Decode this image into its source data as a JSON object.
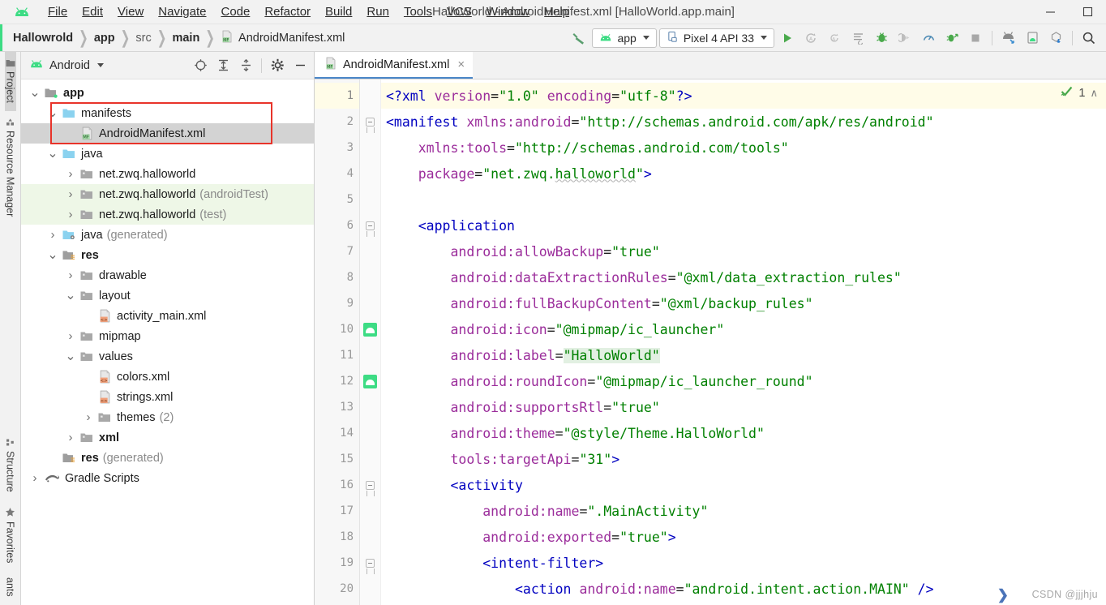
{
  "window": {
    "title": "HalloWorld - AndroidManifest.xml [HalloWorld.app.main]",
    "minimize": "—",
    "maximize": "☐"
  },
  "menu": {
    "items": [
      "File",
      "Edit",
      "View",
      "Navigate",
      "Code",
      "Refactor",
      "Build",
      "Run",
      "Tools",
      "VCS",
      "Window",
      "Help"
    ]
  },
  "breadcrumb": {
    "items": [
      "Hallowrold",
      "app",
      "src",
      "main",
      "AndroidManifest.xml"
    ],
    "separator": "❯"
  },
  "toolbar": {
    "build_hammer": "hammer-icon",
    "run_config": "app",
    "device": "Pixel 4 API 33",
    "run": "run-icon",
    "apply_changes": "apply-changes-icon",
    "icons": [
      "apply-code-changes-icon",
      "logcat-icon",
      "debug-icon",
      "attach-debugger-icon",
      "profiler-icon",
      "run-with-coverage-icon",
      "stop-icon",
      "sdk-manager-icon",
      "avd-manager-icon",
      "sync-gradle-icon",
      "search-everywhere-icon"
    ]
  },
  "toolstrip": {
    "tabs": [
      {
        "label": "Project",
        "icon": "project-folder-icon",
        "selected": true
      },
      {
        "label": "Resource Manager",
        "icon": "resource-manager-icon",
        "selected": false
      },
      {
        "label": "Structure",
        "icon": "structure-icon",
        "selected": false
      },
      {
        "label": "Favorites",
        "icon": "star-icon",
        "selected": false
      },
      {
        "label": "ants",
        "icon": "build-variants-icon",
        "selected": false
      }
    ]
  },
  "project_panel": {
    "view_selector": "Android",
    "actions": [
      "select-opened-file-icon",
      "expand-all-icon",
      "collapse-all-icon",
      "settings-gear-icon",
      "hide-panel-icon"
    ],
    "tree": [
      {
        "indent": 0,
        "arrow": "down",
        "icon": "module-folder-icon",
        "label": "app",
        "suffix": "",
        "bold": true,
        "selected": false,
        "green": false
      },
      {
        "indent": 1,
        "arrow": "down",
        "icon": "folder-icon",
        "label": "manifests",
        "suffix": "",
        "bold": false,
        "selected": false,
        "green": false
      },
      {
        "indent": 2,
        "arrow": "none",
        "icon": "manifest-file-icon",
        "label": "AndroidManifest.xml",
        "suffix": "",
        "bold": false,
        "selected": true,
        "green": false
      },
      {
        "indent": 1,
        "arrow": "down",
        "icon": "folder-icon",
        "label": "java",
        "suffix": "",
        "bold": false,
        "selected": false,
        "green": false
      },
      {
        "indent": 2,
        "arrow": "right",
        "icon": "package-icon",
        "label": "net.zwq.halloworld",
        "suffix": "",
        "bold": false,
        "selected": false,
        "green": false
      },
      {
        "indent": 2,
        "arrow": "right",
        "icon": "package-icon",
        "label": "net.zwq.halloworld",
        "suffix": "(androidTest)",
        "bold": false,
        "selected": false,
        "green": true
      },
      {
        "indent": 2,
        "arrow": "right",
        "icon": "package-icon",
        "label": "net.zwq.halloworld",
        "suffix": "(test)",
        "bold": false,
        "selected": false,
        "green": true
      },
      {
        "indent": 1,
        "arrow": "right",
        "icon": "generated-folder-icon",
        "label": "java",
        "suffix": "(generated)",
        "bold": false,
        "selected": false,
        "green": false
      },
      {
        "indent": 1,
        "arrow": "down",
        "icon": "res-folder-icon",
        "label": "res",
        "suffix": "",
        "bold": true,
        "selected": false,
        "green": false
      },
      {
        "indent": 2,
        "arrow": "right",
        "icon": "package-icon",
        "label": "drawable",
        "suffix": "",
        "bold": false,
        "selected": false,
        "green": false
      },
      {
        "indent": 2,
        "arrow": "down",
        "icon": "package-icon",
        "label": "layout",
        "suffix": "",
        "bold": false,
        "selected": false,
        "green": false
      },
      {
        "indent": 3,
        "arrow": "none",
        "icon": "xml-file-icon",
        "label": "activity_main.xml",
        "suffix": "",
        "bold": false,
        "selected": false,
        "green": false
      },
      {
        "indent": 2,
        "arrow": "right",
        "icon": "package-icon",
        "label": "mipmap",
        "suffix": "",
        "bold": false,
        "selected": false,
        "green": false
      },
      {
        "indent": 2,
        "arrow": "down",
        "icon": "package-icon",
        "label": "values",
        "suffix": "",
        "bold": false,
        "selected": false,
        "green": false
      },
      {
        "indent": 3,
        "arrow": "none",
        "icon": "xml-file-icon",
        "label": "colors.xml",
        "suffix": "",
        "bold": false,
        "selected": false,
        "green": false
      },
      {
        "indent": 3,
        "arrow": "none",
        "icon": "xml-file-icon",
        "label": "strings.xml",
        "suffix": "",
        "bold": false,
        "selected": false,
        "green": false
      },
      {
        "indent": 3,
        "arrow": "right",
        "icon": "package-icon",
        "label": "themes",
        "suffix": "(2)",
        "bold": false,
        "selected": false,
        "green": false
      },
      {
        "indent": 2,
        "arrow": "right",
        "icon": "package-icon",
        "label": "xml",
        "suffix": "",
        "bold": true,
        "selected": false,
        "green": false
      },
      {
        "indent": 1,
        "arrow": "none",
        "icon": "generated-res-icon",
        "label": "res",
        "suffix": "(generated)",
        "bold": true,
        "selected": false,
        "green": false
      },
      {
        "indent": 0,
        "arrow": "right",
        "icon": "gradle-icon",
        "label": "Gradle Scripts",
        "suffix": "",
        "bold": false,
        "selected": false,
        "green": false
      }
    ]
  },
  "editor": {
    "tab": {
      "label": "AndroidManifest.xml",
      "icon": "manifest-file-icon",
      "close": "×"
    },
    "inspection": {
      "count": "1",
      "icon": "inspection-ok-icon",
      "chevron": "∧"
    },
    "lines": [
      {
        "n": "1",
        "current": true,
        "fold": "none",
        "gutter_icon": "none",
        "tokens": [
          {
            "t": "<?xml ",
            "c": "tok-pi"
          },
          {
            "t": "version",
            "c": "tok-attr"
          },
          {
            "t": "=",
            "c": "tok-plain"
          },
          {
            "t": "\"1.0\"",
            "c": "tok-str"
          },
          {
            "t": " ",
            "c": "tok-plain"
          },
          {
            "t": "encoding",
            "c": "tok-attr"
          },
          {
            "t": "=",
            "c": "tok-plain"
          },
          {
            "t": "\"utf-8\"",
            "c": "tok-str"
          },
          {
            "t": "?>",
            "c": "tok-pi"
          }
        ]
      },
      {
        "n": "2",
        "current": false,
        "fold": "open",
        "gutter_icon": "none",
        "tokens": [
          {
            "t": "<manifest ",
            "c": "tok-tag"
          },
          {
            "t": "xmlns:android",
            "c": "tok-attr"
          },
          {
            "t": "=",
            "c": "tok-plain"
          },
          {
            "t": "\"http://schemas.android.com/apk/res/android\"",
            "c": "tok-str"
          }
        ]
      },
      {
        "n": "3",
        "current": false,
        "fold": "none",
        "gutter_icon": "none",
        "tokens": [
          {
            "t": "    ",
            "c": "tok-plain"
          },
          {
            "t": "xmlns:tools",
            "c": "tok-attr"
          },
          {
            "t": "=",
            "c": "tok-plain"
          },
          {
            "t": "\"http://schemas.android.com/tools\"",
            "c": "tok-str"
          }
        ]
      },
      {
        "n": "4",
        "current": false,
        "fold": "none",
        "gutter_icon": "none",
        "tokens": [
          {
            "t": "    ",
            "c": "tok-plain"
          },
          {
            "t": "package",
            "c": "tok-attr"
          },
          {
            "t": "=",
            "c": "tok-plain"
          },
          {
            "t": "\"net.zwq.",
            "c": "tok-str"
          },
          {
            "t": "halloworld",
            "c": "tok-str squiggle"
          },
          {
            "t": "\"",
            "c": "tok-str"
          },
          {
            "t": ">",
            "c": "tok-tag"
          }
        ]
      },
      {
        "n": "5",
        "current": false,
        "fold": "none",
        "gutter_icon": "none",
        "tokens": []
      },
      {
        "n": "6",
        "current": false,
        "fold": "open",
        "gutter_icon": "none",
        "tokens": [
          {
            "t": "    ",
            "c": "tok-plain"
          },
          {
            "t": "<application",
            "c": "tok-tag"
          }
        ]
      },
      {
        "n": "7",
        "current": false,
        "fold": "none",
        "gutter_icon": "none",
        "tokens": [
          {
            "t": "        ",
            "c": "tok-plain"
          },
          {
            "t": "android:allowBackup",
            "c": "tok-attr"
          },
          {
            "t": "=",
            "c": "tok-plain"
          },
          {
            "t": "\"true\"",
            "c": "tok-str"
          }
        ]
      },
      {
        "n": "8",
        "current": false,
        "fold": "none",
        "gutter_icon": "none",
        "tokens": [
          {
            "t": "        ",
            "c": "tok-plain"
          },
          {
            "t": "android:dataExtractionRules",
            "c": "tok-attr"
          },
          {
            "t": "=",
            "c": "tok-plain"
          },
          {
            "t": "\"@xml/data_extraction_rules\"",
            "c": "tok-str"
          }
        ]
      },
      {
        "n": "9",
        "current": false,
        "fold": "none",
        "gutter_icon": "none",
        "tokens": [
          {
            "t": "        ",
            "c": "tok-plain"
          },
          {
            "t": "android:fullBackupContent",
            "c": "tok-attr"
          },
          {
            "t": "=",
            "c": "tok-plain"
          },
          {
            "t": "\"@xml/backup_rules\"",
            "c": "tok-str"
          }
        ]
      },
      {
        "n": "10",
        "current": false,
        "fold": "none",
        "gutter_icon": "launcher",
        "tokens": [
          {
            "t": "        ",
            "c": "tok-plain"
          },
          {
            "t": "android:icon",
            "c": "tok-attr"
          },
          {
            "t": "=",
            "c": "tok-plain"
          },
          {
            "t": "\"@mipmap/ic_launcher\"",
            "c": "tok-str"
          }
        ]
      },
      {
        "n": "11",
        "current": false,
        "fold": "none",
        "gutter_icon": "none",
        "tokens": [
          {
            "t": "        ",
            "c": "tok-plain"
          },
          {
            "t": "android:label",
            "c": "tok-attr"
          },
          {
            "t": "=",
            "c": "tok-plain"
          },
          {
            "t": "\"HalloWorld\"",
            "c": "tok-str hl-green"
          }
        ]
      },
      {
        "n": "12",
        "current": false,
        "fold": "none",
        "gutter_icon": "launcher",
        "tokens": [
          {
            "t": "        ",
            "c": "tok-plain"
          },
          {
            "t": "android:roundIcon",
            "c": "tok-attr"
          },
          {
            "t": "=",
            "c": "tok-plain"
          },
          {
            "t": "\"@mipmap/ic_launcher_round\"",
            "c": "tok-str"
          }
        ]
      },
      {
        "n": "13",
        "current": false,
        "fold": "none",
        "gutter_icon": "none",
        "tokens": [
          {
            "t": "        ",
            "c": "tok-plain"
          },
          {
            "t": "android:supportsRtl",
            "c": "tok-attr"
          },
          {
            "t": "=",
            "c": "tok-plain"
          },
          {
            "t": "\"true\"",
            "c": "tok-str"
          }
        ]
      },
      {
        "n": "14",
        "current": false,
        "fold": "none",
        "gutter_icon": "none",
        "tokens": [
          {
            "t": "        ",
            "c": "tok-plain"
          },
          {
            "t": "android:theme",
            "c": "tok-attr"
          },
          {
            "t": "=",
            "c": "tok-plain"
          },
          {
            "t": "\"@style/Theme.HalloWorld\"",
            "c": "tok-str"
          }
        ]
      },
      {
        "n": "15",
        "current": false,
        "fold": "none",
        "gutter_icon": "none",
        "tokens": [
          {
            "t": "        ",
            "c": "tok-plain"
          },
          {
            "t": "tools:targetApi",
            "c": "tok-attr"
          },
          {
            "t": "=",
            "c": "tok-plain"
          },
          {
            "t": "\"31\"",
            "c": "tok-str"
          },
          {
            "t": ">",
            "c": "tok-tag"
          }
        ]
      },
      {
        "n": "16",
        "current": false,
        "fold": "open",
        "gutter_icon": "none",
        "tokens": [
          {
            "t": "        ",
            "c": "tok-plain"
          },
          {
            "t": "<activity",
            "c": "tok-tag"
          }
        ]
      },
      {
        "n": "17",
        "current": false,
        "fold": "none",
        "gutter_icon": "none",
        "tokens": [
          {
            "t": "            ",
            "c": "tok-plain"
          },
          {
            "t": "android:name",
            "c": "tok-attr"
          },
          {
            "t": "=",
            "c": "tok-plain"
          },
          {
            "t": "\".MainActivity\"",
            "c": "tok-str"
          }
        ]
      },
      {
        "n": "18",
        "current": false,
        "fold": "none",
        "gutter_icon": "none",
        "tokens": [
          {
            "t": "            ",
            "c": "tok-plain"
          },
          {
            "t": "android:exported",
            "c": "tok-attr"
          },
          {
            "t": "=",
            "c": "tok-plain"
          },
          {
            "t": "\"true\"",
            "c": "tok-str"
          },
          {
            "t": ">",
            "c": "tok-tag"
          }
        ]
      },
      {
        "n": "19",
        "current": false,
        "fold": "open",
        "gutter_icon": "none",
        "tokens": [
          {
            "t": "            ",
            "c": "tok-plain"
          },
          {
            "t": "<intent-filter>",
            "c": "tok-tag"
          }
        ]
      },
      {
        "n": "20",
        "current": false,
        "fold": "none",
        "gutter_icon": "none",
        "tokens": [
          {
            "t": "                ",
            "c": "tok-plain"
          },
          {
            "t": "<action ",
            "c": "tok-tag"
          },
          {
            "t": "android:name",
            "c": "tok-attr"
          },
          {
            "t": "=",
            "c": "tok-plain"
          },
          {
            "t": "\"android.intent.action.MAIN\"",
            "c": "tok-str"
          },
          {
            "t": " />",
            "c": "tok-tag"
          }
        ]
      }
    ]
  },
  "watermark": {
    "text": "CSDN @jjjhju"
  },
  "colors": {
    "android_green": "#3ddc84",
    "annotation_red": "#e8342a",
    "selection_grey": "#d3d3d3",
    "test_row_green": "#eef7e7",
    "caret_line": "#fffce8",
    "tab_underline": "#4a86c8"
  }
}
